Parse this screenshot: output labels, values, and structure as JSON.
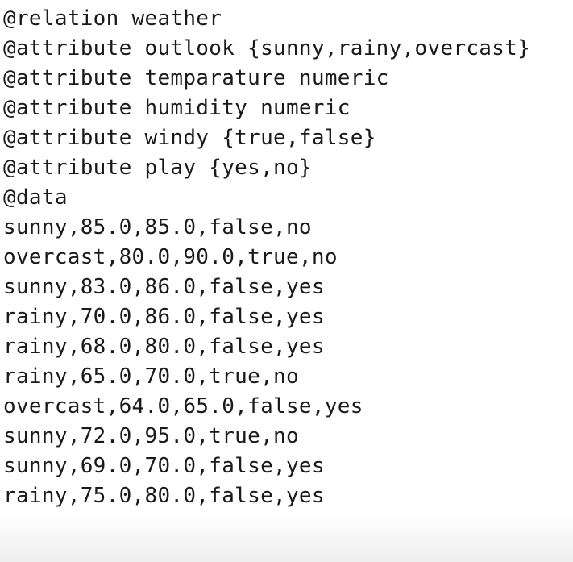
{
  "editor": {
    "lines": [
      "@relation weather",
      "@attribute outlook {sunny,rainy,overcast}",
      "@attribute temparature numeric",
      "@attribute humidity numeric",
      "@attribute windy {true,false}",
      "@attribute play {yes,no}",
      "@data",
      "sunny,85.0,85.0,false,no",
      "overcast,80.0,90.0,true,no",
      "sunny,83.0,86.0,false,yes",
      "rainy,70.0,86.0,false,yes",
      "rainy,68.0,80.0,false,yes",
      "rainy,65.0,70.0,true,no",
      "overcast,64.0,65.0,false,yes",
      "sunny,72.0,95.0,true,no",
      "sunny,69.0,70.0,false,yes",
      "rainy,75.0,80.0,false,yes"
    ],
    "colors": {
      "background": "#ffffff",
      "text": "#1a1a1a"
    }
  }
}
